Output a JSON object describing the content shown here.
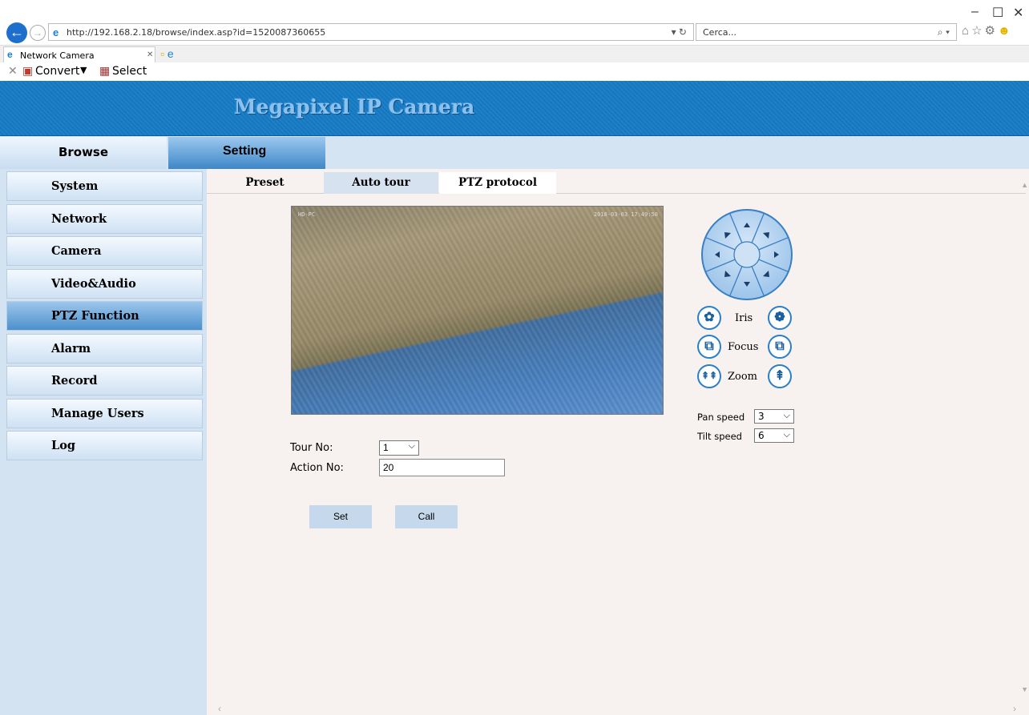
{
  "browser": {
    "url": "http://192.168.2.18/browse/index.asp?id=1520087360655",
    "search_placeholder": "Cerca...",
    "tab_title": "Network Camera",
    "favorites": [
      {
        "label": "Convert",
        "icon": "convert-icon"
      },
      {
        "label": "Select",
        "icon": "select-icon"
      }
    ],
    "window_controls": {
      "minimize": "–",
      "maximize": "☐",
      "close": "✕"
    }
  },
  "app": {
    "banner_title": "Megapixel IP Camera",
    "topnav": {
      "browse": "Browse",
      "setting": "Setting"
    },
    "sidebar": [
      {
        "label": "System",
        "active": false
      },
      {
        "label": "Network",
        "active": false
      },
      {
        "label": "Camera",
        "active": false
      },
      {
        "label": "Video&Audio",
        "active": false
      },
      {
        "label": "PTZ Function",
        "active": true
      },
      {
        "label": "Alarm",
        "active": false
      },
      {
        "label": "Record",
        "active": false
      },
      {
        "label": "Manage Users",
        "active": false
      },
      {
        "label": "Log",
        "active": false
      }
    ],
    "subtabs": {
      "preset": "Preset",
      "auto_tour": "Auto tour",
      "ptz_protocol": "PTZ protocol"
    },
    "selected_subtab": "Auto tour"
  },
  "video": {
    "osd_left": "HD-PC",
    "osd_right": "2018-03-03 17:49:50"
  },
  "ptz": {
    "iris_label": "Iris",
    "focus_label": "Focus",
    "zoom_label": "Zoom",
    "pan_speed_label": "Pan speed",
    "pan_speed_value": "3",
    "tilt_speed_label": "Tilt speed",
    "tilt_speed_value": "6"
  },
  "tour_form": {
    "tour_no_label": "Tour No:",
    "tour_no_value": "1",
    "action_no_label": "Action No:",
    "action_no_value": "20",
    "set_label": "Set",
    "call_label": "Call"
  },
  "colors": {
    "banner": "#1a7bc4",
    "banner_title": "#8ec0ec",
    "sidebar_bg": "#d3e3f2",
    "active_nav": "#4d90cc",
    "main_bg": "#f7f2f0",
    "button_bg": "#c6d9ec"
  }
}
